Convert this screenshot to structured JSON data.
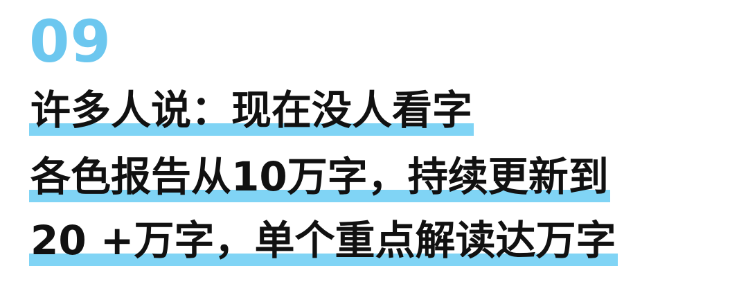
{
  "section_number": "09",
  "lines": [
    "许多人说：现在没人看字",
    "各色报告从10万字，持续更新到",
    "20 +万字，单个重点解读达万字"
  ],
  "colors": {
    "number": "#6cc7ef",
    "highlight": "#80d4f5",
    "text": "#111111",
    "background": "#ffffff"
  }
}
